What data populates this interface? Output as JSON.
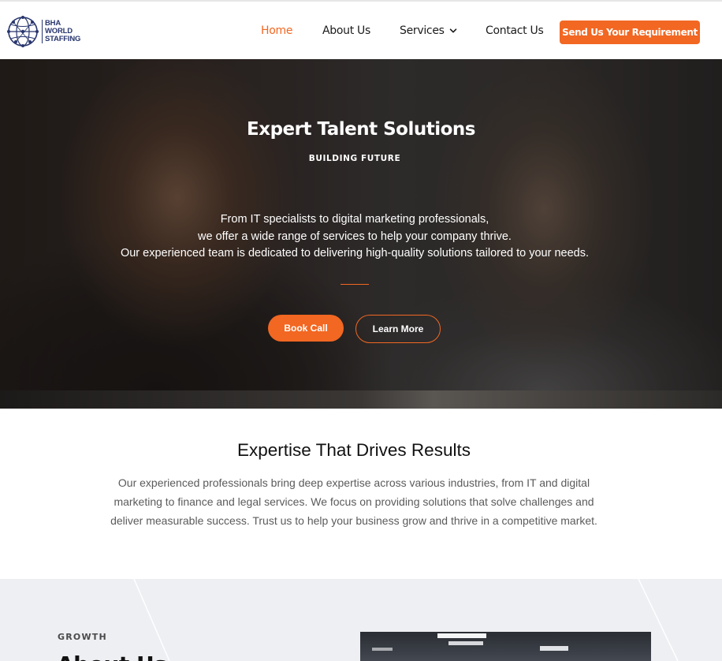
{
  "brand": {
    "logo_lines": [
      "BHA",
      "WORLD",
      "STAFFING"
    ],
    "primary_color": "#f26722",
    "logo_color": "#28366e"
  },
  "nav": {
    "items": [
      {
        "label": "Home",
        "active": true
      },
      {
        "label": "About Us",
        "active": false
      },
      {
        "label": "Services",
        "active": false,
        "has_dropdown": true
      },
      {
        "label": "Contact Us",
        "active": false
      }
    ],
    "cta_label": "Send Us Your Requirement"
  },
  "hero": {
    "title": "Expert Talent Solutions",
    "subtitle": "BUILDING FUTURE",
    "description_lines": [
      "From IT specialists to digital marketing professionals,",
      "we offer a wide range of services to help your company thrive.",
      "Our experienced team is dedicated to delivering high-quality solutions tailored to your needs."
    ],
    "primary_button": "Book Call",
    "secondary_button": "Learn More"
  },
  "expertise": {
    "title": "Expertise That Drives Results",
    "text": "Our experienced professionals bring deep expertise across various industries, from IT and digital marketing to finance and legal services. We focus on providing solutions that solve challenges and deliver measurable success. Trust us to help your business grow and thrive in a competitive market."
  },
  "growth": {
    "label": "GROWTH",
    "heading": "About Us"
  }
}
